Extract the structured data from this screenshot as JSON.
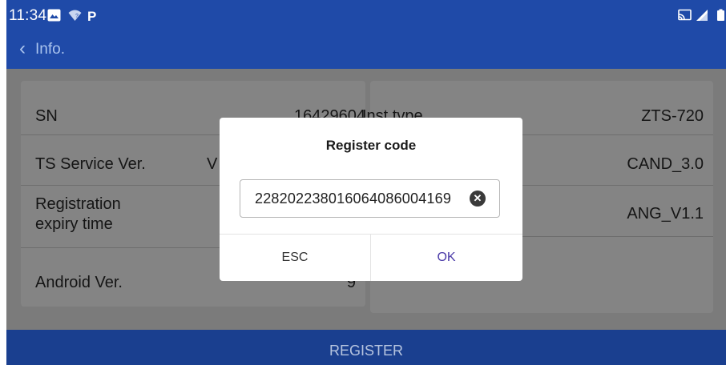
{
  "status_bar": {
    "time": "11:34",
    "icons": [
      "gallery-icon",
      "wifi-icon",
      "parking-icon",
      "cast-icon",
      "signal-icon",
      "battery-icon"
    ]
  },
  "app_bar": {
    "back_icon": "chevron-left-icon",
    "back_glyph": "‹",
    "title": "Info."
  },
  "info": {
    "left": [
      {
        "label": "SN",
        "value": "16429604"
      },
      {
        "label": "TS Service Ver.",
        "value": "V"
      },
      {
        "label": "Registration\nexpiry time",
        "value": ""
      },
      {
        "label": "Android Ver.",
        "value": "9"
      }
    ],
    "right": [
      {
        "label": "Inst.tvpe",
        "value": "ZTS-720"
      },
      {
        "label": "",
        "value": "CAND_3.0"
      },
      {
        "label": "",
        "value": "ANG_V1.1"
      }
    ]
  },
  "register_button": "REGISTER",
  "dialog": {
    "title": "Register code",
    "input_value": "22820223801606408600416­9",
    "clear_icon": "clear-icon",
    "esc_label": "ESC",
    "ok_label": "OK"
  },
  "colors": {
    "app_blue": "#1f4aa8",
    "overlay_gray": "#7b7b7b",
    "ok_purple": "#4a3aa8",
    "esc_gray": "#333333"
  }
}
